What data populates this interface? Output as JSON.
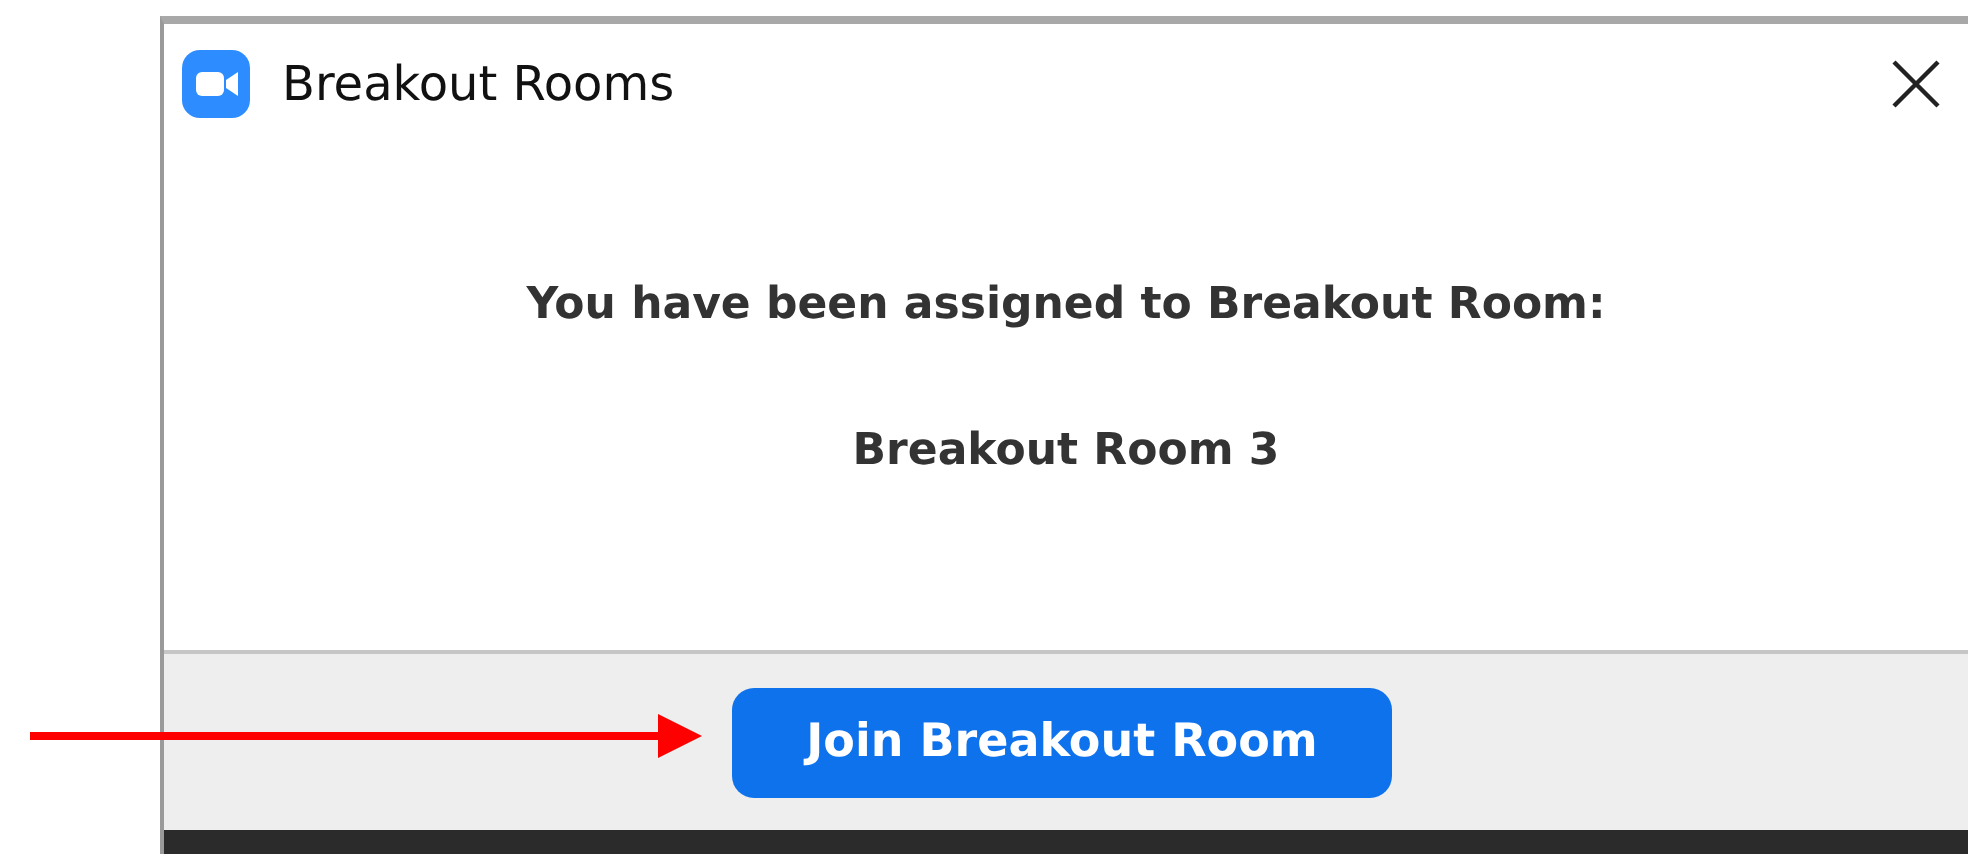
{
  "window": {
    "title": "Breakout Rooms"
  },
  "message": "You have been assigned to Breakout Room:",
  "room_name": "Breakout Room 3",
  "button": "Join Breakout Room"
}
